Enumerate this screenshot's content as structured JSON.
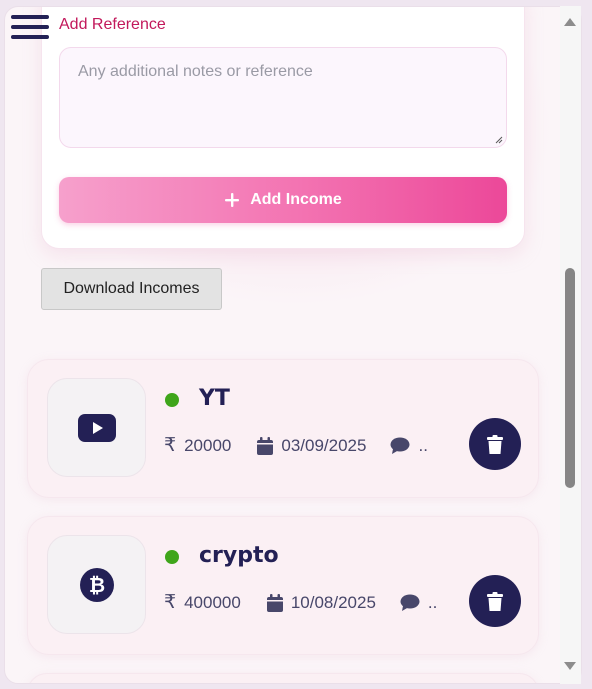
{
  "form": {
    "reference_label": "Add Reference",
    "notes_placeholder": "Any additional notes or reference",
    "add_button_label": "Add Income",
    "add_button_icon": "plus-icon"
  },
  "download_button_label": "Download Incomes",
  "incomes": [
    {
      "title": "YT",
      "icon": "youtube-icon",
      "status_color": "#3fa51a",
      "amount": "20000",
      "date": "03/09/2025",
      "note": ".."
    },
    {
      "title": "crypto",
      "icon": "bitcoin-icon",
      "status_color": "#3fa51a",
      "amount": "400000",
      "date": "10/08/2025",
      "note": ".."
    }
  ],
  "colors": {
    "accent": "#ec4899",
    "label": "#c2185b",
    "navy": "#232055",
    "status_green": "#3fa51a"
  },
  "icons": {
    "currency": "rupee-icon",
    "date": "calendar-icon",
    "note": "comment-icon",
    "delete": "trash-icon",
    "menu": "hamburger-menu-icon"
  }
}
